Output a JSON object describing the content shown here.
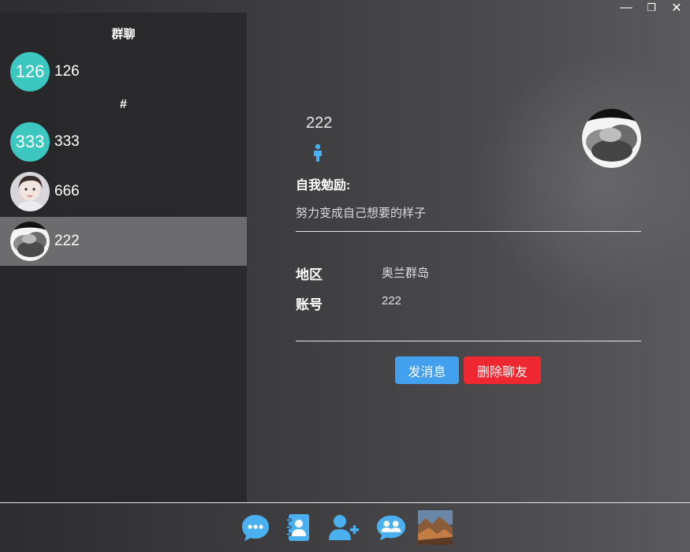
{
  "window": {
    "minimize_glyph": "—",
    "restore_glyph": "❐",
    "close_glyph": "✕"
  },
  "sidebar": {
    "title": "群聊",
    "group_letter": "#",
    "contacts": [
      {
        "avatar_text": "126",
        "name": "126",
        "avatar_type": "number"
      },
      {
        "avatar_text": "333",
        "name": "333",
        "avatar_type": "number"
      },
      {
        "avatar_text": "",
        "name": "666",
        "avatar_type": "portrait-photo"
      },
      {
        "avatar_text": "",
        "name": "222",
        "avatar_type": "storm-cloud-photo",
        "selected": true
      }
    ]
  },
  "detail": {
    "name": "222",
    "gender_icon": "male-icon",
    "motto_label": "自我勉励:",
    "motto_text": "努力变成自己想要的样子",
    "region_label": "地区",
    "region_value": "奥兰群岛",
    "account_label": "账号",
    "account_value": "222",
    "send_button": "发消息",
    "delete_button": "删除聊友"
  },
  "bottom_nav": {
    "items": [
      "chat-icon",
      "contacts-book-icon",
      "add-user-icon",
      "group-icon",
      "user-avatar"
    ]
  },
  "colors": {
    "accent_teal": "#3cc8c0",
    "send_blue": "#43a0ee",
    "delete_red": "#ee2730",
    "icon_blue": "#4ab0f0"
  }
}
